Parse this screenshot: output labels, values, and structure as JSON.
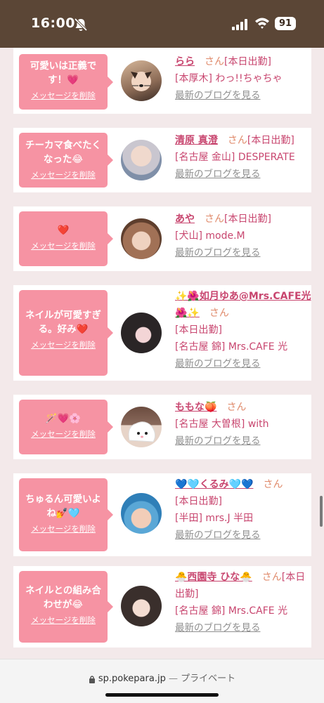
{
  "status_bar": {
    "time": "16:00",
    "battery": "91"
  },
  "blog_link_label": "最新のブログを見る",
  "delete_label": "メッセージを削除",
  "cards": [
    {
      "message": "可愛いは正義です！💗",
      "name": "らら",
      "san": "さん",
      "line1_extra": "[本日出勤]",
      "line2": "[本厚木] わっ!!ちゃちゃ"
    },
    {
      "message": "チーカマ食べたくなった😂",
      "name": "清原 真澄",
      "san": "さん",
      "line1_extra": "[本日出勤]",
      "line2": "[名古屋 金山] DESPERATE"
    },
    {
      "message": "❤️",
      "name": "あや",
      "san": "さん",
      "line1_extra": "[本日出勤]",
      "line2": "[犬山] mode.M"
    },
    {
      "message": "ネイルが可愛すぎる。好み❤️",
      "name": "✨🌺如月ゆあ@Mrs.CAFE光🌺✨",
      "san": "さん",
      "line1_extra": "[本日出勤]",
      "line2": "[名古屋 錦] Mrs.CAFE 光"
    },
    {
      "message": "🪄💗🌸",
      "name": "ももな🍑",
      "san": "さん",
      "line1_extra": "",
      "line2": "[名古屋 大曽根] with"
    },
    {
      "message": "ちゅるん可愛いよね💅🩵",
      "name": "💙🩵くるみ🩵💙",
      "san": "さん",
      "line1_extra": "[本日出勤]",
      "line2": "[半田] mrs.J 半田"
    },
    {
      "message": "ネイルとの組み合わせが😂",
      "name": "🐣西園寺 ひな🐣",
      "san": "さん",
      "line1_extra": "[本日出勤]",
      "line2": "[名古屋 錦] Mrs.CAFE 光"
    }
  ],
  "url_bar": {
    "domain": "sp.pokepara.jp",
    "separator": "—",
    "mode": "プライベート"
  }
}
